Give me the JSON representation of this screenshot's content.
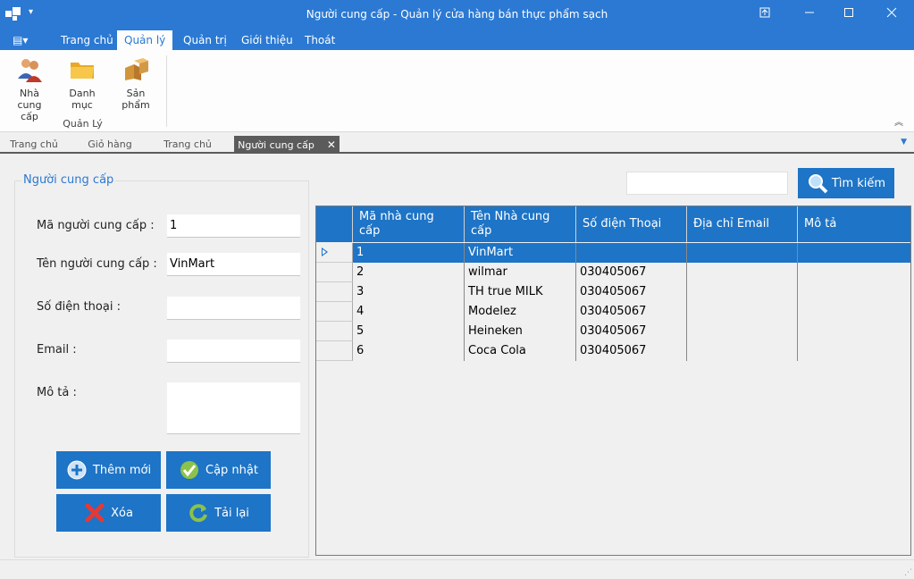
{
  "window": {
    "title": "Người cung cấp - Quản lý cửa hàng bán thực phẩm sạch",
    "quick_access": "▾"
  },
  "ribbon": {
    "menu_glyph": "▤▾",
    "tabs": [
      {
        "label": "Trang chủ"
      },
      {
        "label": "Quản lý"
      },
      {
        "label": "Quản trị"
      },
      {
        "label": "Giới thiệu"
      },
      {
        "label": "Thoát"
      }
    ],
    "buttons": [
      {
        "label": "Nhà cung cấp",
        "icon": "users-icon"
      },
      {
        "label": "Danh mục",
        "icon": "folder-icon"
      },
      {
        "label": "Sản phẩm",
        "icon": "boxes-icon"
      }
    ],
    "group_label": "Quản Lý",
    "collapse_glyph": "︽"
  },
  "doc_tabs": {
    "tabs": [
      {
        "label": "Trang chủ"
      },
      {
        "label": "Giỏ hàng"
      },
      {
        "label": "Trang chủ"
      },
      {
        "label": "Người cung cấp"
      }
    ],
    "close_glyph": "✕",
    "dropdown_glyph": "▼"
  },
  "form": {
    "title": "Người cung cấp",
    "fields": {
      "id": {
        "label": "Mã người cung cấp :",
        "value": "1"
      },
      "name": {
        "label": "Tên người cung cấp :",
        "value": "VinMart"
      },
      "phone": {
        "label": "Số điện thoại :",
        "value": ""
      },
      "email": {
        "label": "Email :",
        "value": ""
      },
      "desc": {
        "label": "Mô tả :",
        "value": ""
      }
    },
    "buttons": {
      "add": "Thêm mới",
      "update": "Cập nhật",
      "delete": "Xóa",
      "reload": "Tải lại"
    }
  },
  "search": {
    "value": "",
    "button": "Tìm kiếm"
  },
  "grid": {
    "columns": [
      "Mã nhà cung cấp",
      "Tên Nhà cung cấp",
      "Số điện Thoại",
      "Địa chỉ Email",
      "Mô tả"
    ],
    "rows": [
      [
        "1",
        "VinMart",
        "",
        "",
        ""
      ],
      [
        "2",
        "wilmar",
        "030405067",
        "",
        ""
      ],
      [
        "3",
        "TH true MILK",
        "030405067",
        "",
        ""
      ],
      [
        "4",
        "Modelez",
        "030405067",
        "",
        ""
      ],
      [
        "5",
        "Heineken",
        "030405067",
        "",
        ""
      ],
      [
        "6",
        "Coca Cola",
        "030405067",
        "",
        ""
      ]
    ]
  },
  "colors": {
    "accent": "#2b79d3",
    "button": "#1e74c6"
  }
}
